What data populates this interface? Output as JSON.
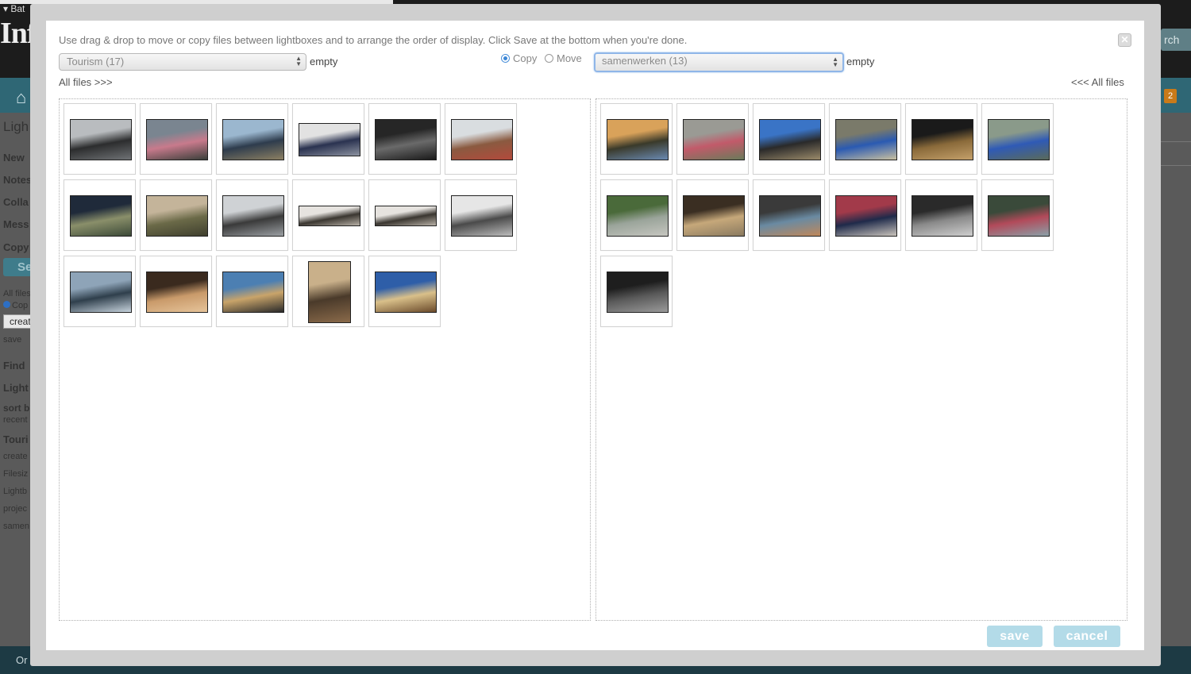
{
  "background": {
    "menu_label": "Bat",
    "logo_text": "Infr",
    "search_label": "rch",
    "home_icon": "home-icon",
    "notification_count": "2",
    "sidebar": {
      "lightbox_heading": "Ligh",
      "new": "New",
      "notes": "Notes",
      "collab": "Colla",
      "messages": "Mess",
      "copy": "Copy",
      "select_button": "Se",
      "all_files": "All files",
      "copy_radio": "Cop",
      "create_input": "creat",
      "save": "save",
      "find": "Find",
      "lightbox2": "Light",
      "sort_by": "sort b",
      "recent": "recent",
      "tourism": "Touri",
      "created": "create",
      "filesize": "Filesiz",
      "lightbox3": "Lightb",
      "project": "projec",
      "samen": "samen"
    },
    "footer_text": "Or"
  },
  "modal": {
    "instructions": "Use drag & drop to move or copy files between lightboxes and to arrange the order of display. Click Save at the bottom when you're done.",
    "close_icon": "close-icon",
    "left_select": "Tourism (17)",
    "left_empty": "empty",
    "right_select": "samenwerken (13)",
    "right_empty": "empty",
    "copy_label": "Copy",
    "move_label": "Move",
    "mode": "copy",
    "left_all_files": "All files >>>",
    "right_all_files": "<<< All files",
    "save_label": "save",
    "cancel_label": "cancel",
    "left_thumbnails": [
      {
        "orient": "landscape",
        "colors": [
          "#b9bcbf",
          "#2c2d2e",
          "#6f7275"
        ]
      },
      {
        "orient": "landscape",
        "colors": [
          "#7a8590",
          "#c87a8c",
          "#3a3f3a"
        ]
      },
      {
        "orient": "landscape",
        "colors": [
          "#9bb7cf",
          "#2e3c4d",
          "#8c8062"
        ]
      },
      {
        "orient": "wide",
        "colors": [
          "#e2e2e2",
          "#2a3250",
          "#8c92a0"
        ]
      },
      {
        "orient": "landscape",
        "colors": [
          "#262626",
          "#6a6a6a",
          "#1a1a1a"
        ]
      },
      {
        "orient": "landscape",
        "colors": [
          "#d9dde0",
          "#8a5a40",
          "#b34a3c"
        ]
      },
      {
        "orient": "landscape",
        "colors": [
          "#1f2a3a",
          "#8a8f6a",
          "#3c4a38"
        ]
      },
      {
        "orient": "landscape",
        "colors": [
          "#c4b49a",
          "#6b6a48",
          "#3f3f2e"
        ]
      },
      {
        "orient": "landscape",
        "colors": [
          "#cfd2d5",
          "#3a3a3a",
          "#9a9ea2"
        ]
      },
      {
        "orient": "panorama",
        "colors": [
          "#e6e3df",
          "#3a3630",
          "#b7b0a6"
        ]
      },
      {
        "orient": "panorama",
        "colors": [
          "#e6e3df",
          "#3a3630",
          "#b7b0a6"
        ]
      },
      {
        "orient": "landscape",
        "colors": [
          "#e6e6e6",
          "#4a4a4a",
          "#bcbcbc"
        ]
      },
      {
        "orient": "landscape",
        "colors": [
          "#8ea4b8",
          "#2f3f4c",
          "#c6d2dc"
        ]
      },
      {
        "orient": "landscape",
        "colors": [
          "#3a2a1e",
          "#c99a6a",
          "#e6c49a"
        ]
      },
      {
        "orient": "landscape",
        "colors": [
          "#4c7fb2",
          "#c9a46a",
          "#2a2a2a"
        ]
      },
      {
        "orient": "portrait",
        "colors": [
          "#c9b08a",
          "#4a3a2a",
          "#8a6a4a"
        ]
      },
      {
        "orient": "landscape",
        "colors": [
          "#2e5ea8",
          "#d9c08a",
          "#6a4a2a"
        ]
      }
    ],
    "right_thumbnails": [
      {
        "orient": "landscape",
        "colors": [
          "#d9a25a",
          "#3a3a2a",
          "#6a8ab2"
        ]
      },
      {
        "orient": "landscape",
        "colors": [
          "#9a9a94",
          "#c25a6a",
          "#6a7a5a"
        ]
      },
      {
        "orient": "landscape",
        "colors": [
          "#3a74c6",
          "#2a2a2a",
          "#9a8a6a"
        ]
      },
      {
        "orient": "landscape",
        "colors": [
          "#7a7a6a",
          "#2a5ab2",
          "#c9c0a0"
        ]
      },
      {
        "orient": "landscape",
        "colors": [
          "#1a1a1a",
          "#8a6a3a",
          "#c4a06a"
        ]
      },
      {
        "orient": "landscape",
        "colors": [
          "#8a9a8a",
          "#2f5ab6",
          "#5a6a5a"
        ]
      },
      {
        "orient": "landscape",
        "colors": [
          "#4a6a3a",
          "#9aa49a",
          "#c6c6c0"
        ]
      },
      {
        "orient": "landscape",
        "colors": [
          "#3a2e22",
          "#c6a87a",
          "#8a7a60"
        ]
      },
      {
        "orient": "landscape",
        "colors": [
          "#3a3a3a",
          "#6a8aa2",
          "#c0885a"
        ]
      },
      {
        "orient": "landscape",
        "colors": [
          "#a23a4a",
          "#1f2a4a",
          "#c9c3bb"
        ]
      },
      {
        "orient": "landscape",
        "colors": [
          "#2a2a2a",
          "#8a8a8a",
          "#cfcfcf"
        ]
      },
      {
        "orient": "landscape",
        "colors": [
          "#3a4a3a",
          "#b24a5a",
          "#8aa0a8"
        ]
      },
      {
        "orient": "landscape",
        "colors": [
          "#1e1e1e",
          "#5a5a5a",
          "#9a9a9a"
        ]
      }
    ]
  }
}
